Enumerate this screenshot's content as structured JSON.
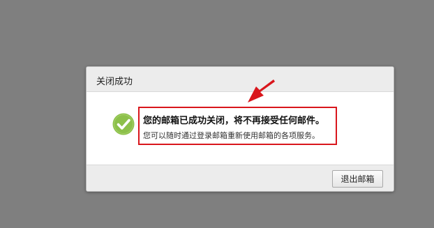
{
  "dialog": {
    "title": "关闭成功",
    "message_title": "您的邮箱已成功关闭，将不再接受任何邮件。",
    "message_sub": "您可以随时通过登录邮箱重新使用邮箱的各项服务。",
    "exit_button_label": "退出邮箱",
    "icon": "check-circle-icon"
  },
  "colors": {
    "overlay": "#7f7f7f",
    "success_green": "#8cc04a",
    "highlight_red": "#d9161c"
  }
}
